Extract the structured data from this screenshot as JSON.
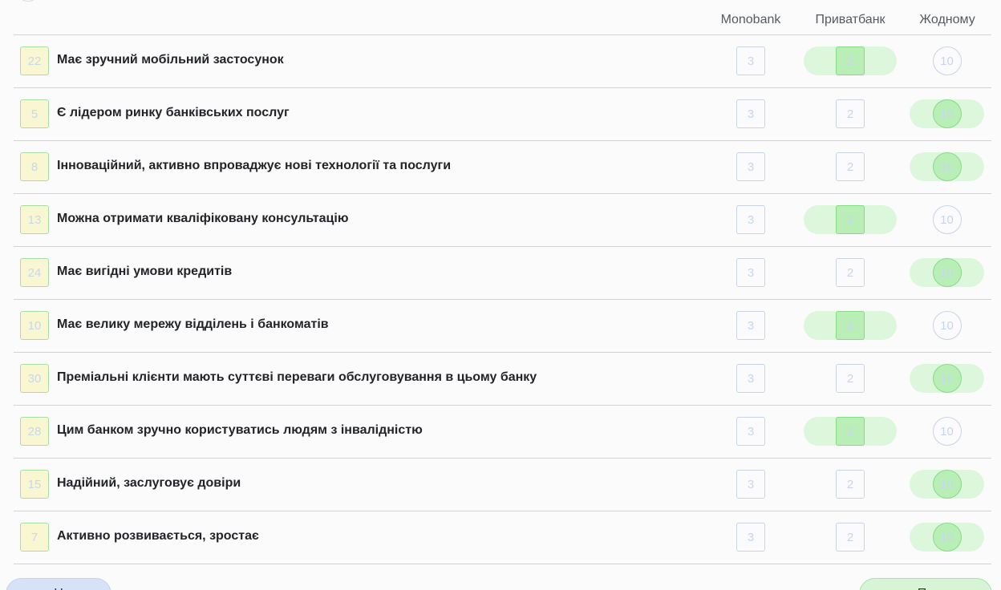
{
  "columns": {
    "monobank": "Monobank",
    "privatbank": "Приватбанк",
    "none": "Жодному"
  },
  "option_values": {
    "monobank": "3",
    "privatbank": "2",
    "none": "10"
  },
  "rows": [
    {
      "num": "22",
      "label": "Має зручний мобільний застосунок",
      "selected": "privatbank"
    },
    {
      "num": "5",
      "label": "Є лідером ринку банківських послуг",
      "selected": "none"
    },
    {
      "num": "8",
      "label": "Інноваційний, активно впроваджує нові технології та послуги",
      "selected": "none"
    },
    {
      "num": "13",
      "label": "Можна отримати кваліфіковану консультацію",
      "selected": "privatbank"
    },
    {
      "num": "24",
      "label": "Має вигідні умови кредитів",
      "selected": "none"
    },
    {
      "num": "10",
      "label": "Має велику мережу відділень і банкоматів",
      "selected": "privatbank"
    },
    {
      "num": "30",
      "label": "Преміальні клієнти мають суттєві переваги обслуговування в цьому банку",
      "selected": "none"
    },
    {
      "num": "28",
      "label": "Цим банком зручно користуватись людям з інвалідністю",
      "selected": "privatbank"
    },
    {
      "num": "15",
      "label": "Надійний, заслуговує довіри",
      "selected": "none"
    },
    {
      "num": "7",
      "label": "Активно розвивається, зростає",
      "selected": "none"
    }
  ],
  "colors": {
    "selected_fill": "#ddf7dc",
    "selected_border": "#88db86",
    "number_badge_bg": "#f9f7d2",
    "divider": "#c7d6e6"
  },
  "footer": {
    "back_label": "Н",
    "next_label": "Па"
  }
}
